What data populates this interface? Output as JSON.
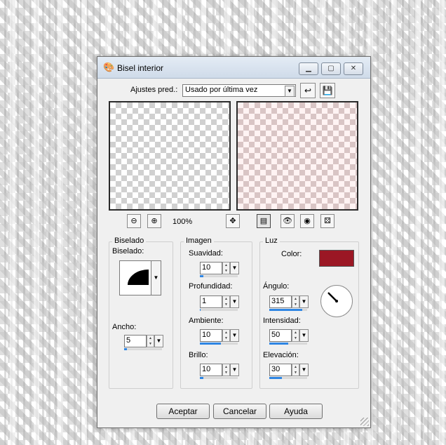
{
  "window": {
    "title": "Bisel interior",
    "app_icon": "paint-palette-icon"
  },
  "presets": {
    "label": "Ajustes pred.:",
    "value": "Usado por última vez"
  },
  "zoom": {
    "level": "100%"
  },
  "bevel": {
    "group_title": "Biselado",
    "label": "Biselado:",
    "width_label": "Ancho:",
    "width_value": "5",
    "width_fraction": 0.08
  },
  "image": {
    "group_title": "Imagen",
    "fields": [
      {
        "label": "Suavidad:",
        "value": "10",
        "fraction": 0.1
      },
      {
        "label": "Profundidad:",
        "value": "1",
        "fraction": 0.02
      },
      {
        "label": "Ambiente:",
        "value": "10",
        "fraction": 0.55
      },
      {
        "label": "Brillo:",
        "value": "10",
        "fraction": 0.1
      }
    ]
  },
  "light": {
    "group_title": "Luz",
    "color_label": "Color:",
    "color": "#9b1724",
    "fields": [
      {
        "label": "Ángulo:",
        "value": "315",
        "fraction": 0.87
      },
      {
        "label": "Intensidad:",
        "value": "50",
        "fraction": 0.5
      },
      {
        "label": "Elevación:",
        "value": "30",
        "fraction": 0.33
      }
    ],
    "angle_degrees": 315
  },
  "buttons": {
    "ok": "Aceptar",
    "cancel": "Cancelar",
    "help": "Ayuda"
  },
  "colors": {
    "accent": "#2f86e4",
    "window_bg": "#f0f0f0"
  }
}
